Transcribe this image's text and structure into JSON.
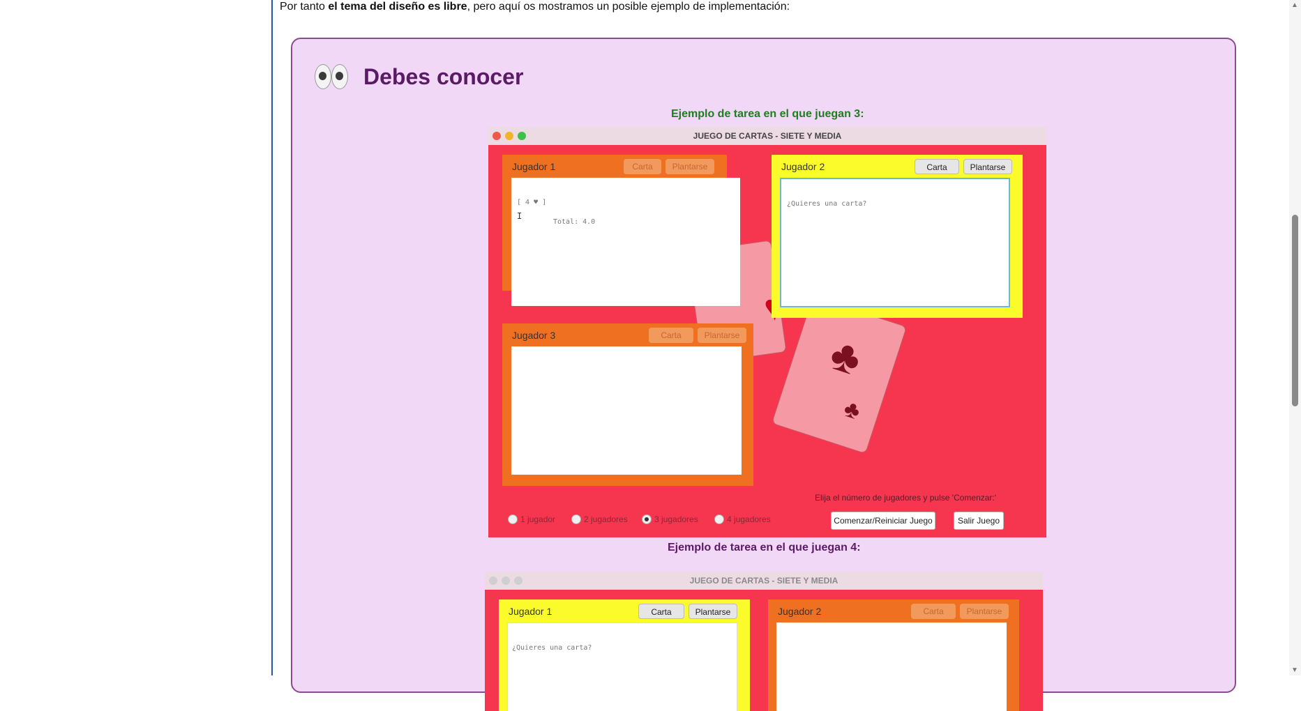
{
  "intro": {
    "pre": "Por tanto ",
    "bold": "el tema del diseño es libre",
    "post": ", pero aquí os mostramos un posible ejemplo de implementación:"
  },
  "box": {
    "title": "Debes conocer",
    "icon": "eyes-icon"
  },
  "captions": {
    "first": "Ejemplo de tarea en el que juegan 3:",
    "second": "Ejemplo de tarea en el que juegan 4:"
  },
  "window1": {
    "title": "JUEGO DE CARTAS - SIETE Y MEDIA",
    "players": [
      {
        "label": "Jugador 1",
        "btn1": "Carta",
        "btn2": "Plantarse",
        "line1": "[ 4 ♥ ]",
        "line2": "Total:  4.0"
      },
      {
        "label": "Jugador 2",
        "btn1": "Carta",
        "btn2": "Plantarse",
        "line1": "¿Quieres una carta?"
      },
      {
        "label": "Jugador 3",
        "btn1": "Carta",
        "btn2": "Plantarse"
      }
    ],
    "instruction": "Elija el número de jugadores y pulse 'Comenzar:'",
    "radios": [
      "1 jugador",
      "2 jugadores",
      "3 jugadores",
      "4 jugadores"
    ],
    "start_button": "Comenzar/Reiniciar Juego",
    "exit_button": "Salir Juego"
  },
  "window2": {
    "title": "JUEGO DE CARTAS - SIETE Y MEDIA",
    "players": [
      {
        "label": "Jugador 1",
        "btn1": "Carta",
        "btn2": "Plantarse",
        "line1": "¿Quieres una carta?"
      },
      {
        "label": "Jugador 2",
        "btn1": "Carta",
        "btn2": "Plantarse"
      }
    ]
  },
  "colors": {
    "window_bg": "#f5364e",
    "panel_active": "#fbfb2c",
    "panel_inactive": "#f07022",
    "box_bg": "#f2d8f7",
    "box_title": "#5a1a66"
  }
}
